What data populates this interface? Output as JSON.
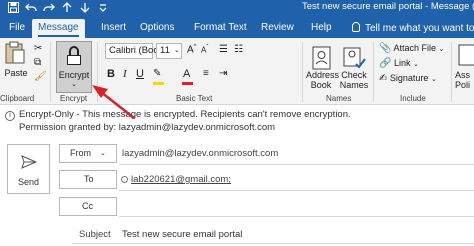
{
  "titlebar": {
    "title": "Test new secure email portal  -  Message (HTM",
    "icons": [
      "save-icon",
      "undo-icon",
      "redo-icon",
      "up-arrow-icon",
      "down-arrow-icon",
      "customize-icon"
    ],
    "background": "#1f61ab"
  },
  "tabs": [
    {
      "label": "File",
      "active": false
    },
    {
      "label": "Message",
      "active": true
    },
    {
      "label": "Insert",
      "active": false
    },
    {
      "label": "Options",
      "active": false
    },
    {
      "label": "Format Text",
      "active": false
    },
    {
      "label": "Review",
      "active": false
    },
    {
      "label": "Help",
      "active": false
    }
  ],
  "tellme": "Tell me what you want to do",
  "ribbon": {
    "clipboard": {
      "paste": "Paste",
      "group": "Clipboard"
    },
    "encrypt": {
      "label": "Encrypt",
      "group": "Encrypt"
    },
    "font": {
      "name": "Calibri (Bod",
      "size": "11",
      "group": "Basic Text"
    },
    "names": {
      "address_book": "Address",
      "address_book_2": "Book",
      "check_names": "Check",
      "check_names_2": "Names",
      "group": "Names"
    },
    "include": {
      "attach_file": "Attach File",
      "link": "Link",
      "signature": "Signature",
      "group": "Include"
    },
    "assistant": {
      "label": "Ass",
      "label2": "Poli"
    }
  },
  "infobar": {
    "line1": "Encrypt-Only - This message is encrypted. Recipients can't remove encryption.",
    "line2": "Permission granted by: lazyadmin@lazydev.onmicrosoft.com"
  },
  "compose": {
    "send": "Send",
    "from_label": "From",
    "from_value": "lazyadmin@lazydev.onmicrosoft.com",
    "to_label": "To",
    "to_value": "lab220621@gmail.com;",
    "cc_label": "Cc",
    "subject_label": "Subject",
    "subject_value": "Test new secure email portal"
  },
  "colors": {
    "accent": "#1f61ab",
    "arrow": "#d9232a",
    "ribbon": "#f3f3f3"
  }
}
